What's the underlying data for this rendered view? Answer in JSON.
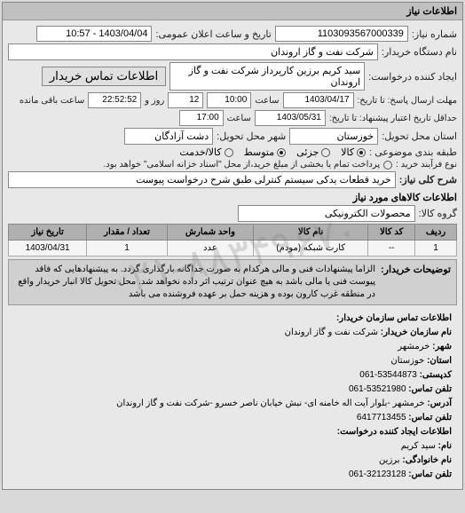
{
  "panel": {
    "title": "اطلاعات نیاز"
  },
  "header": {
    "req_no_label": "شماره نیاز:",
    "req_no": "1103093567000339",
    "announce_label": "تاریخ و ساعت اعلان عمومی:",
    "announce_value": "1403/04/04 - 10:57",
    "buyer_label": "نام دستگاه خریدار:",
    "buyer_value": "شرکت نفت و گاز اروندان",
    "creator_label": "ایجاد کننده درخواست:",
    "creator_value": "سید کریم برزین کارپرداز شرکت نفت و گاز اروندان",
    "buyer_contact_btn": "اطلاعات تماس خریدار"
  },
  "deadlines": {
    "reply_until_label": "مهلت ارسال پاسخ: تا تاریخ:",
    "reply_date": "1403/04/17",
    "time_label": "ساعت",
    "reply_time": "10:00",
    "days_count": "12",
    "days_and": "روز و",
    "countdown": "22:52:52",
    "remain": "ساعت باقی مانده",
    "validity_label": "حداقل تاریخ اعتبار پیشنهاد: تا تاریخ:",
    "validity_date": "1403/05/31",
    "validity_time": "17:00"
  },
  "location": {
    "province_label": "استان محل تحویل:",
    "province": "خوزستان",
    "city_label": "شهر محل تحویل:",
    "city": "دشت آزادگان"
  },
  "classify": {
    "label": "طبقه بندی موضوعی :",
    "opt_goods": "کالا",
    "opt_service": "خدمت",
    "opt_partial": "جزئی",
    "opt_medium": "متوسط",
    "opt_cash": "کالا/خدمت"
  },
  "purchase": {
    "label": "نوع فرآیند خرید :",
    "text": "پرداخت تمام یا بخشی از مبلغ خرید،از محل \"اسناد خزانه اسلامی\" خواهد بود."
  },
  "need": {
    "title_label": "شرح کلی نیاز:",
    "title_value": "خرید قطعات یدکی سیستم کنترلی طبق شرح درخواست پیوست"
  },
  "goods": {
    "section": "اطلاعات کالاهای مورد نیاز",
    "group_label": "گروه کالا:",
    "group_value": "محصولات الکترونیکی"
  },
  "table": {
    "headers": [
      "ردیف",
      "کد کالا",
      "نام کالا",
      "واحد شمارش",
      "تعداد / مقدار",
      "تاریخ نیاز"
    ],
    "rows": [
      {
        "idx": "1",
        "code": "--",
        "name": "کارت شبکه (مودم)",
        "unit": "عدد",
        "qty": "1",
        "date": "1403/04/31"
      }
    ]
  },
  "desc": {
    "label": "توضیحات خریدار:",
    "text": "الزاما پیشنهادات فنی و مالی هرکدام به صورت جداگانه بارگذاری گردد. به پیشنهادهایی که فاقد پیوست فنی یا مالی باشد به هیچ عنوان ترتیب اثر داده نخواهد شد. محل تحویل کالا انبار خریدار واقع در منطقه غرب کارون بوده و هزینه حمل بر عهده فروشنده می باشد"
  },
  "contact": {
    "section": "اطلاعات تماس سازمان خریدار:",
    "org_label": "نام سازمان خریدار:",
    "org": "شرکت نفت و گاز اروندان",
    "city_label": "شهر:",
    "city": "خرمشهر",
    "province_label": "استان:",
    "province": "خوزستان",
    "postal_label": "کدپستی:",
    "postal": "53544873-061",
    "phone_label": "تلفن تماس:",
    "phone": "53521980-061",
    "address_label": "آدرس:",
    "address": "خرمشهر -بلوار آیت اله خامنه ای- نبش خیابان ناصر خسرو -شرکت نفت و گاز اروندان",
    "fax_label": "تلفن تماس:",
    "fax": "6417713455",
    "creator_section": "اطلاعات ایجاد کننده درخواست:",
    "c_name_label": "نام:",
    "c_name": "سید کریم",
    "c_lname_label": "نام خانوادگی:",
    "c_lname": "برزین",
    "c_phone_label": "تلفن تماس:",
    "c_phone": "32123128-061"
  },
  "watermark": "۰۲۱-۸۸۳۴۹۶۷۰"
}
